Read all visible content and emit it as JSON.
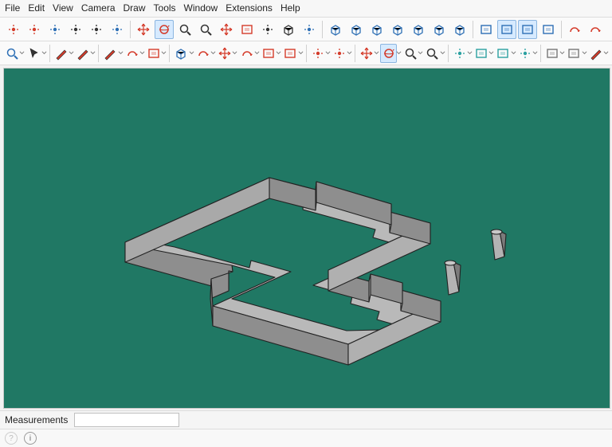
{
  "menu": {
    "items": [
      "File",
      "Edit",
      "View",
      "Camera",
      "Draw",
      "Tools",
      "Window",
      "Extensions",
      "Help"
    ]
  },
  "toolbar_row1": {
    "buttons": [
      {
        "name": "draw-tool",
        "c": "red"
      },
      {
        "name": "points-tool",
        "c": "red"
      },
      {
        "name": "tag-tool",
        "c": "blue"
      },
      {
        "name": "text-label-tool",
        "c": "black"
      },
      {
        "name": "dimension-tool",
        "c": "black"
      },
      {
        "name": "walk-tool",
        "c": "blue"
      },
      {
        "name": "sep"
      },
      {
        "name": "move-tool",
        "c": "red"
      },
      {
        "name": "orbit-tool",
        "c": "red",
        "active": true
      },
      {
        "name": "zoom-tool",
        "c": "black"
      },
      {
        "name": "zoom-window-tool",
        "c": "black"
      },
      {
        "name": "axes-tool",
        "c": "red"
      },
      {
        "name": "section-tool",
        "c": "red"
      },
      {
        "name": "pan-tool",
        "c": "black"
      },
      {
        "name": "previous-view-tool",
        "c": "black"
      },
      {
        "name": "look-around-tool",
        "c": "blue"
      },
      {
        "name": "sep"
      },
      {
        "name": "iso-view",
        "c": "blue"
      },
      {
        "name": "top-view",
        "c": "blue"
      },
      {
        "name": "front-view",
        "c": "blue"
      },
      {
        "name": "right-view",
        "c": "blue"
      },
      {
        "name": "back-view",
        "c": "blue"
      },
      {
        "name": "left-view",
        "c": "blue"
      },
      {
        "name": "bottom-view",
        "c": "blue"
      },
      {
        "name": "sep"
      },
      {
        "name": "section-plane",
        "c": "blue"
      },
      {
        "name": "section-display",
        "c": "blue",
        "active": true
      },
      {
        "name": "section-cut",
        "c": "blue",
        "active": true
      },
      {
        "name": "section-fill",
        "c": "blue"
      },
      {
        "name": "sep"
      },
      {
        "name": "refresh-tool",
        "c": "red"
      },
      {
        "name": "sync-tool",
        "c": "red"
      }
    ]
  },
  "toolbar_row2": {
    "buttons": [
      {
        "name": "search-tool",
        "c": "blue",
        "dd": true
      },
      {
        "name": "select-tool",
        "c": "black",
        "dd": true
      },
      {
        "name": "sep"
      },
      {
        "name": "eraser-tool",
        "c": "red",
        "dd": true
      },
      {
        "name": "pencil-tool",
        "c": "red",
        "dd": true
      },
      {
        "name": "sep"
      },
      {
        "name": "line-tool",
        "c": "red",
        "dd": true
      },
      {
        "name": "arc-tool",
        "c": "red",
        "dd": true
      },
      {
        "name": "rectangle-tool",
        "c": "red",
        "dd": true
      },
      {
        "name": "sep"
      },
      {
        "name": "pushpull-tool",
        "c": "blue",
        "dd": true
      },
      {
        "name": "follow-me-tool",
        "c": "red",
        "dd": true
      },
      {
        "name": "move-transform-tool",
        "c": "red",
        "dd": true
      },
      {
        "name": "rotate-tool",
        "c": "red",
        "dd": true
      },
      {
        "name": "scale-tool",
        "c": "red",
        "dd": true
      },
      {
        "name": "offset-tool",
        "c": "red",
        "dd": true
      },
      {
        "name": "sep"
      },
      {
        "name": "tape-measure-tool",
        "c": "red",
        "dd": true
      },
      {
        "name": "paint-bucket-tool",
        "c": "red",
        "dd": true
      },
      {
        "name": "sep"
      },
      {
        "name": "move-arrows-tool",
        "c": "red",
        "dd": true
      },
      {
        "name": "orbit2-tool",
        "c": "red",
        "active": true,
        "dd": true
      },
      {
        "name": "zoom2-tool",
        "c": "black",
        "dd": true
      },
      {
        "name": "zoom-extents-tool",
        "c": "black",
        "dd": true
      },
      {
        "name": "sep"
      },
      {
        "name": "gear-tool",
        "c": "teal",
        "dd": true
      },
      {
        "name": "tags-tool",
        "c": "teal",
        "dd": true
      },
      {
        "name": "layers-tool",
        "c": "teal",
        "dd": true
      },
      {
        "name": "scissors-tool",
        "c": "teal",
        "dd": true
      },
      {
        "name": "sep"
      },
      {
        "name": "paste-tool",
        "c": "gray",
        "dd": true
      },
      {
        "name": "copy-tool",
        "c": "gray",
        "dd": true
      },
      {
        "name": "knife-tool",
        "c": "red",
        "dd": true
      }
    ]
  },
  "status": {
    "measurements_label": "Measurements",
    "measurements_value": ""
  },
  "footer": {
    "hint_icon": "?",
    "info_icon": "i"
  },
  "viewport": {
    "bgcolor": "#207864"
  }
}
